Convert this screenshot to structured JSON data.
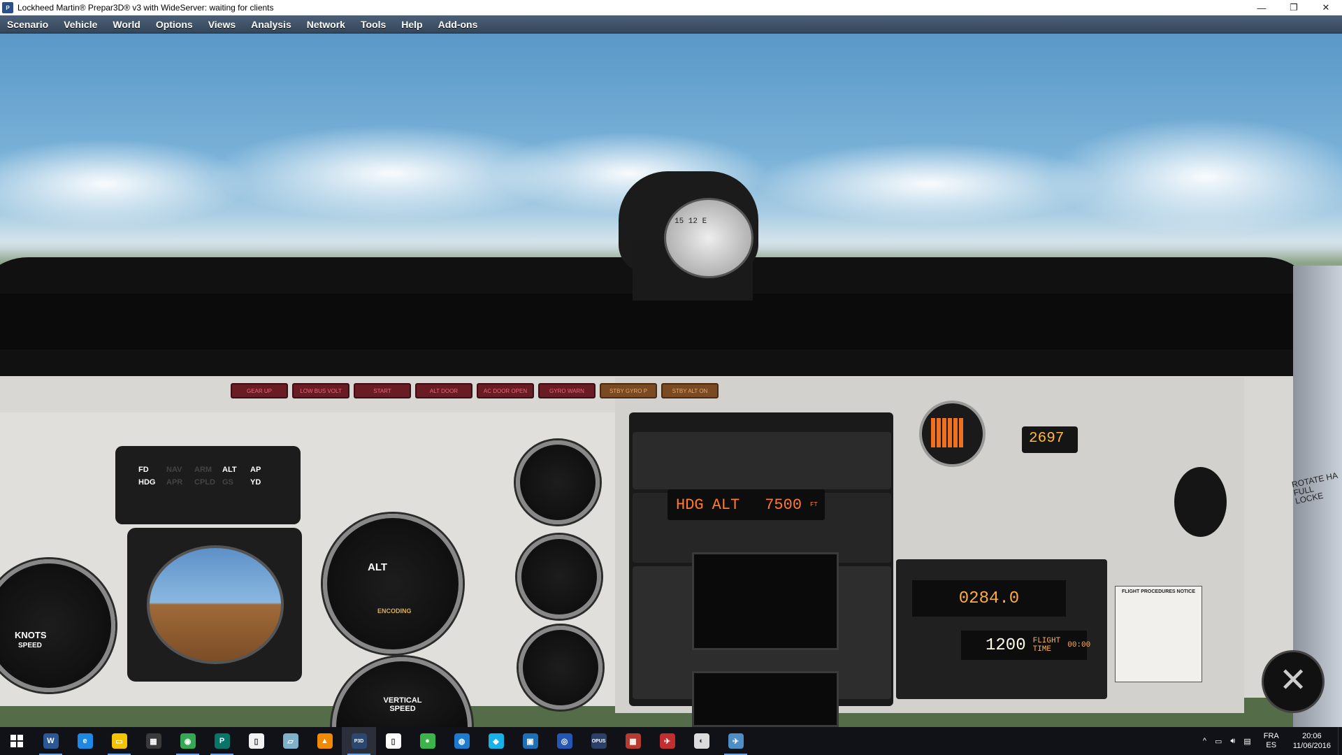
{
  "window": {
    "title": "Lockheed Martin® Prepar3D® v3 with WideServer: waiting for clients",
    "controls": {
      "minimize": "—",
      "restore": "❐",
      "close": "✕"
    }
  },
  "menu": {
    "items": [
      "Scenario",
      "Vehicle",
      "World",
      "Options",
      "Views",
      "Analysis",
      "Network",
      "Tools",
      "Help",
      "Add-ons"
    ]
  },
  "cockpit": {
    "annunciators": [
      "GEAR UP",
      "LOW BUS VOLT",
      "START",
      "ALT DOOR",
      "AC DOOR OPEN",
      "GYRO WARN",
      "STBY GYRO P",
      "STBY ALT ON"
    ],
    "compass_card": "15 12 E",
    "fd_panel": [
      "FD",
      "NAV",
      "ARM",
      "ALT",
      "AP",
      "HDG",
      "APR",
      "CPLD",
      "GS",
      "YD"
    ],
    "altimeter": {
      "label": "ALT",
      "sub": "ENCODING"
    },
    "airspeed": {
      "label": "KNOTS",
      "sub": "SPEED"
    },
    "vsi": {
      "label": "VERTICAL SPEED"
    },
    "autopilot": {
      "mode1": "HDG",
      "mode2": "ALT",
      "altitude": "7500",
      "unit": "FT"
    },
    "adf_freq": "0284.0",
    "transponder": {
      "code": "1200",
      "flight_time_label": "FLIGHT TIME",
      "flight_time": "00:00"
    },
    "hobbs": "2697",
    "placard": {
      "title": "FLIGHT PROCEDURES NOTICE"
    },
    "rotate_label": "ROTATE HA FULL LOCKE"
  },
  "taskbar": {
    "icons": [
      {
        "name": "word-icon",
        "glyph": "W",
        "color": "#2b5797",
        "running": true
      },
      {
        "name": "edge-icon",
        "glyph": "e",
        "color": "#1e88e5",
        "running": false
      },
      {
        "name": "file-explorer-icon",
        "glyph": "▭",
        "color": "#f5c400",
        "running": true
      },
      {
        "name": "store-icon",
        "glyph": "▦",
        "color": "#3a3a3a",
        "running": false
      },
      {
        "name": "chrome-icon",
        "glyph": "◉",
        "color": "#34a853",
        "running": true
      },
      {
        "name": "publisher-icon",
        "glyph": "P",
        "color": "#077568",
        "running": true
      },
      {
        "name": "document-icon",
        "glyph": "▯",
        "color": "#f2f2f2",
        "running": false
      },
      {
        "name": "notepad-icon",
        "glyph": "▱",
        "color": "#7fb2c9",
        "running": false
      },
      {
        "name": "vlc-icon",
        "glyph": "▲",
        "color": "#f08a00",
        "running": false
      },
      {
        "name": "prepar3d-icon",
        "glyph": "P3D",
        "color": "#2c4770",
        "running": true
      },
      {
        "name": "blank-file-icon",
        "glyph": "▯",
        "color": "#ffffff",
        "running": false
      },
      {
        "name": "green-app-icon",
        "glyph": "●",
        "color": "#3bb54a",
        "running": false
      },
      {
        "name": "network-app-icon",
        "glyph": "◍",
        "color": "#1c7bd1",
        "running": false
      },
      {
        "name": "kodi-icon",
        "glyph": "◆",
        "color": "#17b2e7",
        "running": false
      },
      {
        "name": "remote-desktop-icon",
        "glyph": "▣",
        "color": "#1d6fb8",
        "running": false
      },
      {
        "name": "globe-icon",
        "glyph": "◎",
        "color": "#2456b5",
        "running": false
      },
      {
        "name": "opus-icon",
        "glyph": "OPUS",
        "color": "#2c3f66",
        "running": false
      },
      {
        "name": "colorful-app-icon",
        "glyph": "▦",
        "color": "#b53a2f",
        "running": false
      },
      {
        "name": "red-jet-icon",
        "glyph": "✈",
        "color": "#c22d2d",
        "running": false
      },
      {
        "name": "disc-icon",
        "glyph": "◐",
        "color": "#dcdcdc",
        "running": false
      },
      {
        "name": "aircraft-app-icon",
        "glyph": "✈",
        "color": "#4d8ec7",
        "running": true
      }
    ],
    "tray": {
      "chevron": "^",
      "lang_top": "FRA",
      "lang_bottom": "ES",
      "time": "20:06",
      "date": "11/06/2016"
    }
  },
  "colors": {
    "menubar": "#3f5268",
    "annunciator_red": "#6a1c25",
    "led_orange": "#ff7a2a"
  }
}
